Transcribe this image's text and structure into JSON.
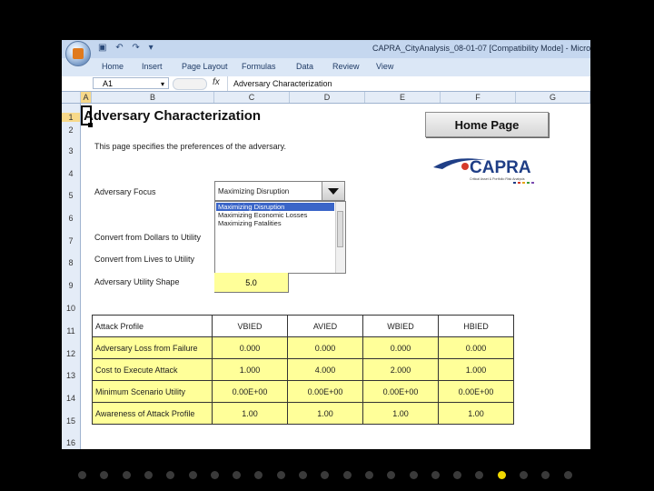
{
  "window": {
    "title": "CAPRA_CityAnalysis_08-01-07 [Compatibility Mode] - Micro",
    "qat": [
      "▣",
      "↶",
      "↷",
      "▾"
    ]
  },
  "ribbon": {
    "tabs": [
      "Home",
      "Insert",
      "Page Layout",
      "Formulas",
      "Data",
      "Review",
      "View"
    ]
  },
  "formula_bar": {
    "cell_ref": "A1",
    "fx": "fx",
    "content": "Adversary Characterization"
  },
  "columns": [
    "A",
    "B",
    "C",
    "D",
    "E",
    "F",
    "G"
  ],
  "rows": [
    "1",
    "2",
    "3",
    "4",
    "5",
    "6",
    "7",
    "8",
    "9",
    "10",
    "11",
    "12",
    "13",
    "14",
    "15",
    "16"
  ],
  "sheet": {
    "title": "Adversary Characterization",
    "home_button": "Home Page",
    "logo_text": "CAPRA",
    "logo_sub": "Critical Asset & Portfolio Risk Analysis",
    "description": "This page specifies the preferences of the adversary.",
    "focus_label": "Adversary Focus",
    "focus_value": "Maximizing Disruption",
    "focus_options": [
      "Maximizing Disruption",
      "Maximizing Economic Losses",
      "Maximizing Fatalities"
    ],
    "dollars_label": "Convert from Dollars to Utility",
    "lives_label": "Convert from Lives to Utility",
    "shape_label": "Adversary Utility Shape",
    "shape_value": "5.0"
  },
  "attack_table": {
    "header": [
      "Attack Profile",
      "VBIED",
      "AVIED",
      "WBIED",
      "HBIED"
    ],
    "rows": [
      {
        "label": "Adversary Loss from Failure",
        "values": [
          "0.000",
          "0.000",
          "0.000",
          "0.000"
        ]
      },
      {
        "label": "Cost to Execute Attack",
        "values": [
          "1.000",
          "4.000",
          "2.000",
          "1.000"
        ]
      },
      {
        "label": "Minimum Scenario Utility",
        "values": [
          "0.00E+00",
          "0.00E+00",
          "0.00E+00",
          "0.00E+00"
        ]
      },
      {
        "label": "Awareness of Attack Profile",
        "values": [
          "1.00",
          "1.00",
          "1.00",
          "1.00"
        ]
      }
    ]
  },
  "slides": {
    "count": 23,
    "active": 20
  },
  "colors": {
    "accent_yellow": "#ffff99",
    "ribbon": "#dbe7f6",
    "active_dot": "#f0d800"
  }
}
